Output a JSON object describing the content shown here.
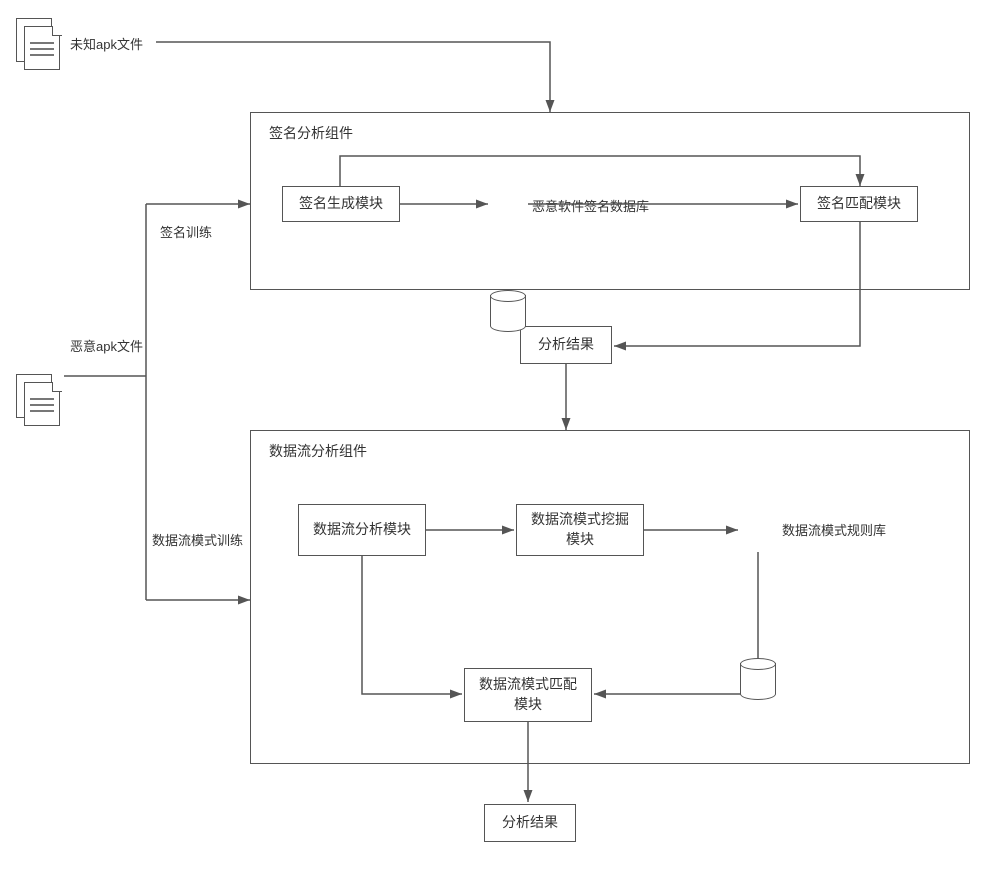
{
  "inputs": {
    "unknown_apk": "未知apk文件",
    "malicious_apk": "恶意apk文件"
  },
  "flow_labels": {
    "signature_training": "签名训练",
    "dataflow_pattern_training": "数据流模式训练"
  },
  "signature_component": {
    "title": "签名分析组件",
    "generator": "签名生成模块",
    "database": "恶意软件签名数据库",
    "matcher": "签名匹配模块",
    "result": "分析结果"
  },
  "dataflow_component": {
    "title": "数据流分析组件",
    "analyzer": "数据流分析模块",
    "miner": "数据流模式挖掘模块",
    "rulebase": "数据流模式规则库",
    "matcher": "数据流模式匹配模块",
    "result": "分析结果"
  }
}
